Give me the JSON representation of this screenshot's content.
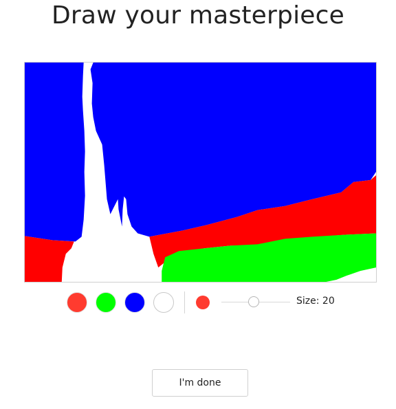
{
  "page": {
    "title": "Draw your masterpiece"
  },
  "canvas": {
    "background": "#ffffff",
    "strokes": [
      {
        "color": "blue",
        "hex": "#0000ff"
      },
      {
        "color": "red",
        "hex": "#ff0000"
      },
      {
        "color": "green",
        "hex": "#00ff00"
      }
    ]
  },
  "palette": {
    "colors": [
      {
        "name": "red",
        "hex": "#ff3b2f",
        "border": "#e0e0e0"
      },
      {
        "name": "green",
        "hex": "#00ff00",
        "border": "#e0e0e0"
      },
      {
        "name": "blue",
        "hex": "#0000ff",
        "border": "#e0e0e0"
      },
      {
        "name": "white",
        "hex": "#ffffff",
        "border": "#c8c8c8"
      }
    ],
    "selected_color": "red",
    "selected_hex": "#ff3b2f"
  },
  "brush": {
    "size": 20,
    "min": 1,
    "max": 100,
    "size_label": "Size: 20"
  },
  "actions": {
    "done_label": "I'm done"
  }
}
